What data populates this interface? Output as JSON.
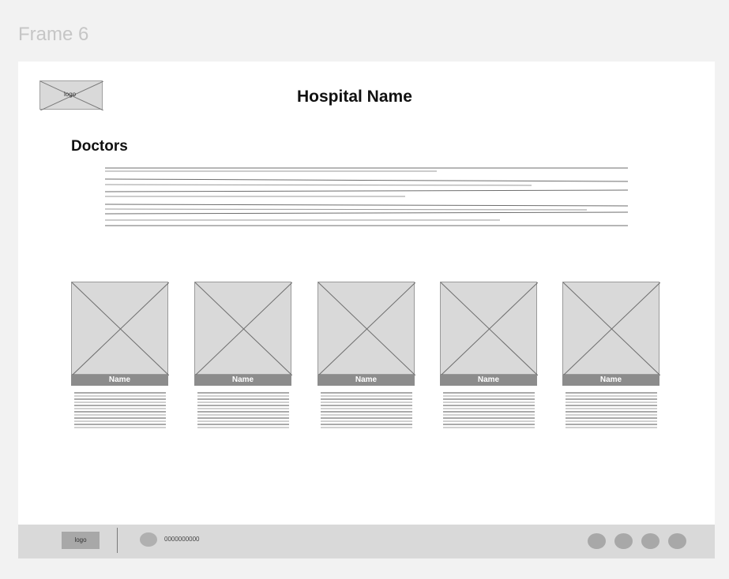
{
  "frame_label": "Frame 6",
  "header": {
    "logo_text": "logo",
    "hospital_name": "Hospital Name"
  },
  "section": {
    "title": "Doctors"
  },
  "doctors": [
    {
      "name": "Name"
    },
    {
      "name": "Name"
    },
    {
      "name": "Name"
    },
    {
      "name": "Name"
    },
    {
      "name": "Name"
    }
  ],
  "footer": {
    "logo_text": "logo",
    "contact_text": "0000000000",
    "phone_icon": "phone-icon",
    "social_icons": [
      "social-icon-1",
      "social-icon-2",
      "social-icon-3",
      "social-icon-4"
    ]
  },
  "colors": {
    "canvas": "#f2f2f2",
    "frame": "#ffffff",
    "placeholder": "#d9d9d9",
    "name_bar": "#8c8c8c",
    "footer": "#d9d9d9",
    "footer_icon": "#a8a8a8"
  }
}
